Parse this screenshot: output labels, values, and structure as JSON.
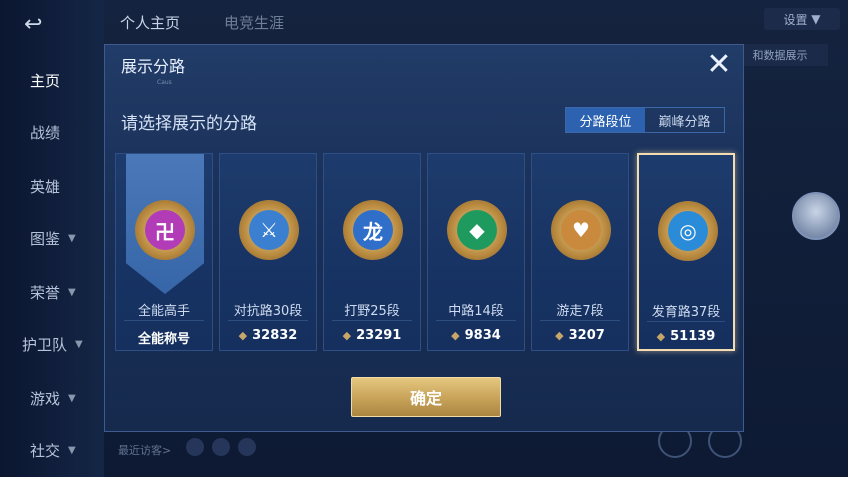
{
  "background": {
    "sidebar": [
      {
        "label": "主页",
        "active": true
      },
      {
        "label": "战绩"
      },
      {
        "label": "英雄"
      },
      {
        "label": "图鉴",
        "chevron": true
      },
      {
        "label": "荣誉",
        "chevron": true
      },
      {
        "label": "护卫队",
        "chevron": true
      },
      {
        "label": "游戏",
        "chevron": true
      },
      {
        "label": "社交",
        "chevron": true
      }
    ],
    "tabs": [
      {
        "label": "个人主页"
      },
      {
        "label": "电竞生涯"
      }
    ],
    "top_right_label": "设置",
    "right_button": "和数据展示",
    "visitors_label": "最近访客>"
  },
  "modal": {
    "title": "展示分路",
    "title_sub": "Caus",
    "close_glyph": "✕",
    "prompt": "请选择展示的分路",
    "segments": [
      {
        "label": "分路段位",
        "active": true
      },
      {
        "label": "巅峰分路",
        "active": false
      }
    ],
    "cards": [
      {
        "label": "全能高手",
        "score": "全能称号",
        "banner": true,
        "emblem_color": "#b23bb8",
        "emblem_glyph": "卍"
      },
      {
        "label": "对抗路30段",
        "score": "32832",
        "emblem_color": "#3b7fd0",
        "emblem_glyph": "⚔"
      },
      {
        "label": "打野25段",
        "score": "23291",
        "emblem_color": "#2f6fc9",
        "emblem_glyph": "龙"
      },
      {
        "label": "中路14段",
        "score": "9834",
        "emblem_color": "#1f9a5e",
        "emblem_glyph": "◆"
      },
      {
        "label": "游走7段",
        "score": "3207",
        "emblem_color": "#c98a3e",
        "emblem_glyph": "♥"
      },
      {
        "label": "发育路37段",
        "score": "51139",
        "emblem_color": "#2a8bd8",
        "emblem_glyph": "◎",
        "selected": true
      }
    ],
    "confirm_label": "确定"
  },
  "colors": {
    "accent": "#2c62b0",
    "gold": "#d4b06a",
    "select_border": "#f2dcb0"
  }
}
